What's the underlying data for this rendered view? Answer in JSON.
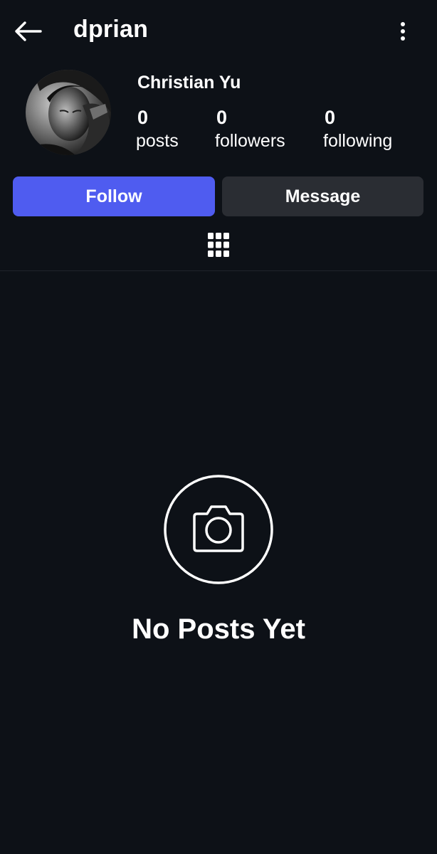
{
  "header": {
    "username": "dprian",
    "back_icon": "arrow-left-icon",
    "more_icon": "more-vertical-icon"
  },
  "profile": {
    "display_name": "Christian Yu",
    "avatar_icon": "profile-photo",
    "stats": [
      {
        "value": "0",
        "label": "posts"
      },
      {
        "value": "0",
        "label": "followers"
      },
      {
        "value": "0",
        "label": "following"
      }
    ]
  },
  "actions": {
    "follow_label": "Follow",
    "message_label": "Message"
  },
  "tabs": {
    "grid_icon": "grid-icon"
  },
  "empty_state": {
    "icon": "camera-icon",
    "title": "No Posts Yet"
  },
  "colors": {
    "background": "#0d1117",
    "follow_button": "#4f5cf0",
    "message_button": "#2a2d33",
    "text": "#ffffff"
  }
}
